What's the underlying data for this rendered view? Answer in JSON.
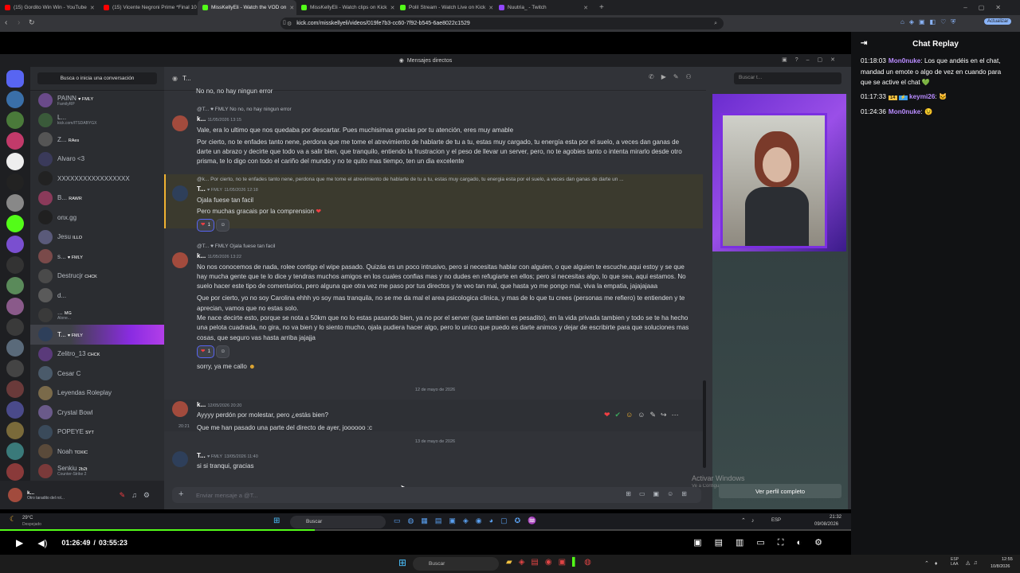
{
  "browser": {
    "tabs": [
      {
        "label": "(15) Gordito Win Win - YouTube",
        "color": "#ff0000"
      },
      {
        "label": "(15) Vicente Negroni Prime *Final 10",
        "color": "#ff0000"
      },
      {
        "label": "MissKellyEli - Watch the VOD on",
        "color": "#53fc18",
        "active": true
      },
      {
        "label": "MissKellyEli - Watch clips on Kick",
        "color": "#53fc18"
      },
      {
        "label": "PoliI Stream - Watch Live on Kick",
        "color": "#53fc18"
      },
      {
        "label": "Nuutria_ - Twitch",
        "color": "#9146ff"
      }
    ],
    "url": "kick.com/misskellyeli/videos/019fe7b3-cc60-7f92-b545-6ae8022c1529",
    "update_label": "Actualizar"
  },
  "discord": {
    "window_title": "Mensajes directos",
    "search_dm": "Busca o inicia una conversación",
    "chat_header": "T...",
    "search_chat": "Buscar t...",
    "dms": [
      {
        "name": "PAINN",
        "tag": "♥ FMLY",
        "sub": "FamilyRP"
      },
      {
        "name": "L...",
        "tag": "",
        "sub": "kick.com/ITSDABYGX"
      },
      {
        "name": "Z...",
        "tag": "RAes",
        "sub": ""
      },
      {
        "name": "Alvaro <3",
        "tag": "",
        "sub": ""
      },
      {
        "name": "XXXXXXXXXXXXXXXXX",
        "tag": "",
        "sub": ""
      },
      {
        "name": "B...",
        "tag": "RAWR",
        "sub": ""
      },
      {
        "name": "onx.gg",
        "tag": "",
        "sub": ""
      },
      {
        "name": "Jesu",
        "tag": "ILLO",
        "sub": ""
      },
      {
        "name": "s...",
        "tag": "♥ FMLY",
        "sub": ""
      },
      {
        "name": "Destrucjr",
        "tag": "CHCK",
        "sub": ""
      },
      {
        "name": "d...",
        "tag": "",
        "sub": ""
      },
      {
        "name": "...",
        "tag": "MG",
        "sub": "Alone..."
      },
      {
        "name": "T...",
        "tag": "♥ FMLY",
        "sub": "",
        "selected": true
      },
      {
        "name": "Zelitro_13",
        "tag": "CHCK",
        "sub": ""
      },
      {
        "name": "Cesar C",
        "tag": "",
        "sub": ""
      },
      {
        "name": "Leyendas Roleplay",
        "tag": "",
        "sub": ""
      },
      {
        "name": "Crystal Bowl",
        "tag": "",
        "sub": ""
      },
      {
        "name": "POPEYE",
        "tag": "SYT",
        "sub": ""
      },
      {
        "name": "Noah",
        "tag": "TOXIC",
        "sub": ""
      },
      {
        "name": "Senkiu",
        "tag": "2b2t",
        "sub": "Counter-Strike 2"
      }
    ],
    "user_footer": {
      "name": "k...",
      "status": "Otro taradito del rol..."
    },
    "messages": {
      "m0": "No no, no hay ningun error",
      "m1_reply": "@T... ♥ FMLY  No no, no hay ningun error",
      "m1_author": "k...",
      "m1_date": "11/05/2026 13:15",
      "m1_l1": "Vale, era lo ultimo que nos quedaba por descartar. Pues muchisimas gracias por tu atención, eres muy amable",
      "m1_l2": "Por cierto, no te enfades tanto nene, perdona que me tome el atrevimiento de hablarte de tu a tu, estas muy cargado, tu energía esta por el suelo, a veces dan ganas de darte un abrazo y decirte que todo va a salir bien, que tranquilo, entiendo la frustracion y el peso de llevar un server, pero, no te agobies tanto o intenta mirarlo desde otro prisma, te lo digo con todo el cariño del mundo y no te quito mas tiempo, ten un dia excelente",
      "m2_reply": "@k...  Por cierto, no te enfades tanto nene, perdona que me tome el atrevimiento de hablarte de tu a tu, estas muy cargado, tu energia esta por el suelo, a veces dan ganas de darte un ...",
      "m2_author": "T...",
      "m2_tag": "♥ FMLY",
      "m2_date": "11/05/2026 12:18",
      "m2_l1": "Ojala fuese tan facil",
      "m2_l2": "Pero muchas gracais por la comprension",
      "m2_react_count": "1",
      "m3_reply": "@T... ♥ FMLY  Ojala fuese tan facil",
      "m3_author": "k...",
      "m3_date": "11/05/2026 13:22",
      "m3_l1": "No nos conocemos de nada, rolee contigo el wipe pasado. Quizás es un poco intrusivo, pero si necesitas hablar con alguien, o que alguien te escuche,aqui estoy y se que hay mucha gente que te lo dice y tendras muchos amigos en los cuales confias mas y no dudes en refugiarte en ellos; pero si necesitas algo, lo que sea, aqui estamos. No suelo hacer este tipo de comentarios, pero alguna que otra vez me paso por tus directos y te veo tan mal, que hasta yo me pongo mal, viva la empatia, jajajajaaa",
      "m3_l2": "Que por cierto, yo no soy Carolina ehhh yo soy mas tranquila, no se me da mal el area psicologica clinica, y mas de lo que tu crees (personas me refiero) te entienden y te aprecian, vamos que no estas solo.",
      "m3_l3": "Me nace decirte esto, porque se nota a 50km que no lo estas pasando bien, ya no por el server (que tambien es pesadito), en la vida privada tambien y todo se te ha hecho una pelota cuadrada, no gira, no va bien y lo siento mucho, ojala pudiera hacer algo, pero lo unico que puedo es darte animos y dejar de escribirte para que soluciones mas cosas, que seguro vas hasta arriba jajajja",
      "m3_react_count": "1",
      "m3_l4": "sorry, ya me callo",
      "div1": "12 de mayo de 2026",
      "m4_author": "k...",
      "m4_date": "12/05/2026 20:20",
      "m4_l1": "Ayyyy perdón por molestar, pero ¿estás bien?",
      "m4_time2": "20:21",
      "m4_l2": "Que me han pasado una parte del directo de ayer, joooooo :c",
      "div2": "13 de mayo de 2026",
      "m5_author": "T...",
      "m5_tag": "♥ FMLY",
      "m5_date": "13/05/2026 11:40",
      "m5_l1": "si si tranqui, gracias"
    },
    "composer_placeholder": "Enviar mensaje a @T...",
    "view_profile": "Ver perfil completo",
    "activate_windows": "Activar Windows",
    "activate_sub": "Ve a Configuración para activar Windows."
  },
  "inner_taskbar": {
    "weather": "29°C",
    "weather_sub": "Despejado",
    "search": "Buscar",
    "lang": "ESP",
    "time": "21:32",
    "date": "09/08/2026"
  },
  "player": {
    "current": "01:26:49",
    "total": "03:55:23",
    "separator": "/",
    "progress": 0.37
  },
  "chat_replay": {
    "title": "Chat Replay",
    "messages": [
      {
        "time": "01:18:03",
        "user": "Mon0nuke",
        "text": "Los que andéis en el chat, mandad un emote o algo de vez en cuando para que se active el chat 💚"
      },
      {
        "time": "01:17:33",
        "badge": "14",
        "user": "keymi26",
        "text": "🐱"
      },
      {
        "time": "01:24:36",
        "user": "Mon0nuke",
        "text": "😉"
      }
    ]
  },
  "win_taskbar": {
    "search": "Buscar",
    "lang": "ESP\nLAA",
    "time": "12:55",
    "date": "10/8/2026"
  },
  "colors": {
    "kick_green": "#53fc18",
    "discord_blurple": "#5865f2",
    "selected_dm": "#b23fe8",
    "username": "#b98cff"
  }
}
